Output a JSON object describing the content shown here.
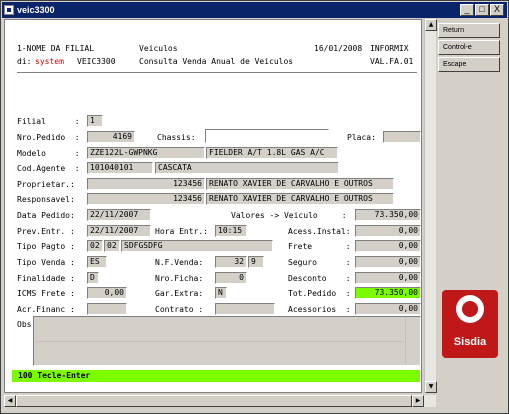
{
  "window": {
    "title": "veic3300",
    "buttons": {
      "min": "_",
      "max": "□",
      "close": "X"
    }
  },
  "header": {
    "line1_left": "1-NOME DA FILIAL",
    "line1_mid": "Veiculos",
    "line1_date": "16/01/2008",
    "line1_right": "INFORMIX",
    "line2_prefix": "di:",
    "line2_sys": "system",
    "line2_prog": "VEIC3300",
    "line2_mid": "Consulta Venda Anual de Veiculos",
    "line2_right": "VAL.FA.01"
  },
  "side_buttons": [
    "Return",
    "Control-e",
    "Escape"
  ],
  "logo_text": "Sisdia",
  "form": {
    "filial": {
      "label": "Filial      :",
      "value": "1"
    },
    "pedido": {
      "label": "Nro.Pedido  :",
      "value": "4169",
      "chassis_label": "Chassis:",
      "chassis": "",
      "placa_label": "Placa:",
      "placa": ""
    },
    "modelo": {
      "label": "Modelo      :",
      "code": "ZZE122L-GWPNKG",
      "desc": "FIELDER A/T 1.8L GAS A/C"
    },
    "agente": {
      "label": "Cod.Agente  :",
      "code": "101040101",
      "name": "CASCATA"
    },
    "proprietario": {
      "label": "Proprietar.:",
      "code": "123456",
      "name": "RENATO XAVIER DE CARVALHO E OUTROS"
    },
    "responsavel": {
      "label": "Responsavel:",
      "code": "123456",
      "name": "RENATO XAVIER DE CARVALHO E OUTROS"
    },
    "data_pedido": {
      "label": "Data Pedido:",
      "value": "22/11/2007"
    },
    "valores_label": "Valores -> Veiculo     :",
    "veiculo": "73.350,00",
    "prev_entr": {
      "label": "Prev.Entr. :",
      "value": "22/11/2007",
      "hora_label": "Hora Entr.:",
      "hora": "10:15"
    },
    "acess_label": "Acess.Instal:",
    "acess": "0,00",
    "tipo_pagto": {
      "label": "Tipo Pagto :",
      "c1": "02",
      "c2": "02",
      "desc": "SDFGSDFG"
    },
    "frete_label": "Frete       :",
    "frete": "0,00",
    "tipo_venda": {
      "label": "Tipo Venda :",
      "value": "ES",
      "nf_label": "N.F.Venda:",
      "nf1": "32",
      "nf2": "9"
    },
    "seguro_label": "Seguro      :",
    "seguro": "0,00",
    "finalidade": {
      "label": "Finalidade :",
      "value": "D",
      "ficha_label": "Nro.Ficha:",
      "ficha": "0"
    },
    "desconto_label": "Desconto    :",
    "desconto": "0,00",
    "icms": {
      "label": "ICMS Frete :",
      "value": "0,00",
      "gar_label": "Gar.Extra:",
      "gar": "N"
    },
    "tot_label": "Tot.Pedido  :",
    "tot": "73.350,00",
    "acr": {
      "label": "Acr.Financ :",
      "value": "",
      "contrato_label": "Contrato :",
      "contrato": ""
    },
    "acessorios_label": "Acessorios  :",
    "acessorios": "0,00",
    "obs_label": "Obs"
  },
  "status_message": "100 Tecle-Enter"
}
